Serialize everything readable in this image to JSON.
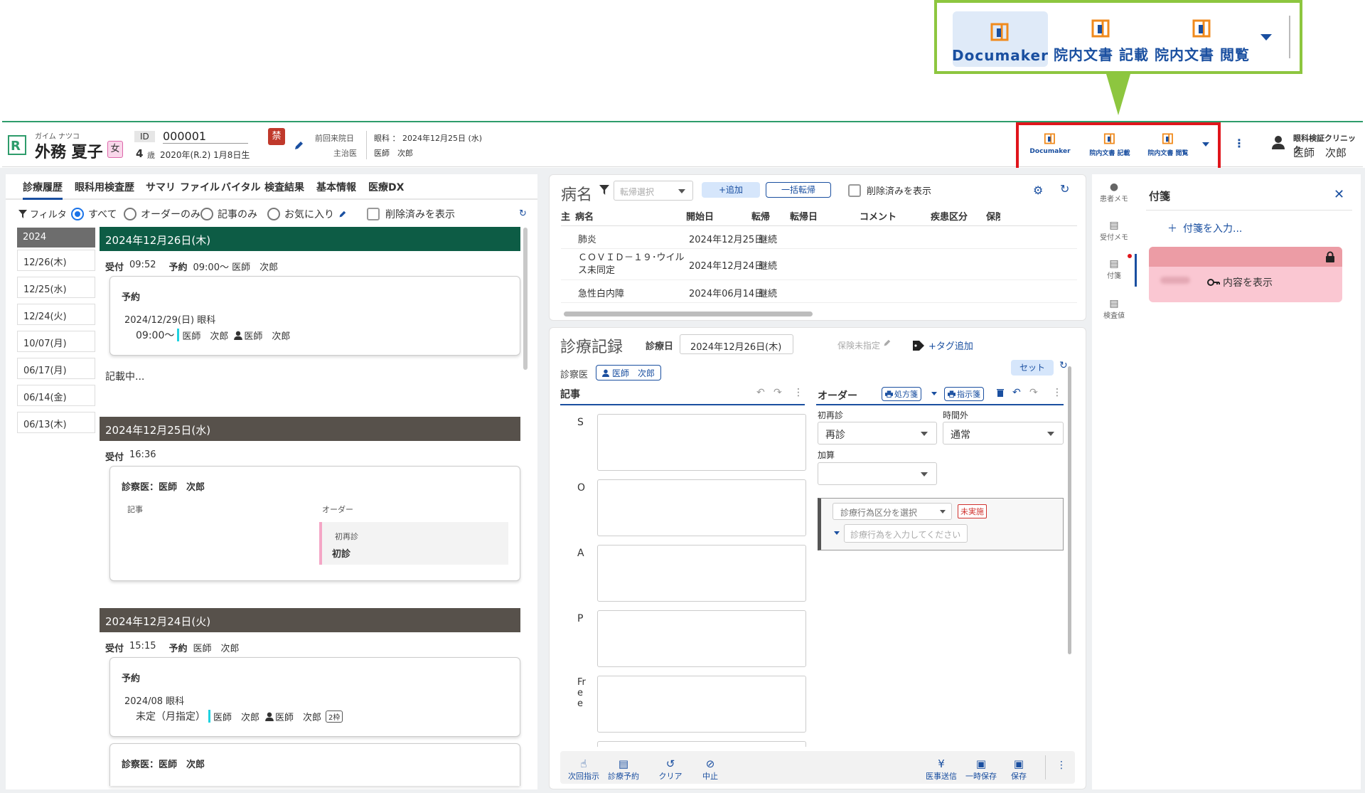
{
  "callout": {
    "buttons": [
      {
        "label": "Documaker"
      },
      {
        "label": "院内文書 記載"
      },
      {
        "label": "院内文書 閲覧"
      }
    ]
  },
  "header": {
    "kana": "ガイム ナツコ",
    "name": "外務 夏子",
    "sex": "女",
    "id_label": "ID",
    "id": "000001",
    "age": "4",
    "age_unit": "歳",
    "birth": "2020年(R.2) 1月8日生",
    "ban": "禁",
    "last_visit_label": "前回来院日",
    "last_visit": "眼科 ： 2024年12月25日 (水)",
    "doctor_label": "主治医",
    "doctor": "医師　次郎",
    "toolbar": [
      "Documaker",
      "院内文書 記載",
      "院内文書 閲覧"
    ],
    "clinic": "眼科検証クリニック",
    "user": "医師　次郎"
  },
  "left": {
    "tabs": [
      "診療履歴",
      "眼科用検査歴",
      "サマリ",
      "ファイル",
      "バイタル",
      "検査結果",
      "基本情報",
      "医療DX"
    ],
    "filter_label": "フィルタ",
    "filters": [
      "すべて",
      "オーダーのみ",
      "記事のみ",
      "お気に入り"
    ],
    "show_deleted": "削除済みを表示",
    "year": "2024",
    "dates": [
      "12/26(木)",
      "12/25(水)",
      "12/24(火)",
      "10/07(月)",
      "06/17(月)",
      "06/14(金)",
      "06/13(木)"
    ],
    "day1": {
      "title": "2024年12月26日(木)",
      "reception": "受付",
      "reception_time": "09:52",
      "reserve_label": "予約",
      "reserve_info": "09:00～ 医師　次郎",
      "card_title": "予約",
      "card_date": "2024/12/29(日) 眼科",
      "card_time": "09:00～",
      "card_doc1": "医師　次郎",
      "card_doc2": "医師　次郎",
      "writing": "記載中..."
    },
    "day2": {
      "title": "2024年12月25日(水)",
      "reception": "受付",
      "reception_time": "16:36",
      "card_title": "診察医：医師　次郎",
      "col_article": "記事",
      "col_order": "オーダー",
      "order_cat": "初再診",
      "order_val": "初診"
    },
    "day3": {
      "title": "2024年12月24日(火)",
      "reception": "受付",
      "reception_time": "15:15",
      "reserve_label": "予約",
      "reserve_info": "医師　次郎",
      "card_title": "予約",
      "card_date": "2024/08 眼科",
      "card_time": "未定（月指定）",
      "card_doc1": "医師　次郎",
      "card_doc2": "医師　次郎",
      "badge": "2枠",
      "card2_title": "診察医：医師　次郎"
    }
  },
  "disease": {
    "title": "病名",
    "outcome_placeholder": "転帰選択",
    "add": "+追加",
    "bulk": "一括転帰",
    "show_deleted": "削除済みを表示",
    "headers": [
      "主",
      "病名",
      "開始日",
      "転帰",
      "転帰日",
      "コメント",
      "疾患区分",
      "保険"
    ],
    "rows": [
      {
        "name": "肺炎",
        "start": "2024年12月25日",
        "outcome": "継続"
      },
      {
        "name": "ＣＯＶＩＤ－１９･ウイルス未同定",
        "start": "2024年12月24日",
        "outcome": "継続"
      },
      {
        "name": "急性白内障",
        "start": "2024年06月14日",
        "outcome": "継続"
      }
    ]
  },
  "record": {
    "title": "診療記録",
    "date_label": "診療日",
    "date": "2024年12月26日(木)",
    "insurance": "保険未指定",
    "tag_add": "+タグ追加",
    "set": "セット",
    "doctor_label": "診察医",
    "doctor": "医師　次郎",
    "article": "記事",
    "soap": [
      "S",
      "O",
      "A",
      "P",
      "Free"
    ],
    "order": "オーダー",
    "prescription": "処方箋",
    "instruction": "指示箋",
    "visit_type_label": "初再診",
    "visit_type": "再診",
    "hours_label": "時間外",
    "hours": "通常",
    "addition_label": "加算",
    "act_select": "診療行為区分を選択",
    "not_done": "未実施",
    "act_placeholder": "診療行為を入力してください",
    "footer": [
      "次回指示",
      "診療予約",
      "クリア",
      "中止",
      "医事送信",
      "一時保存",
      "保存"
    ]
  },
  "right": {
    "side": [
      "患者メモ",
      "受付メモ",
      "付箋",
      "検査値"
    ],
    "title": "付箋",
    "add": "付箋を入力...",
    "show": "内容を表示"
  }
}
